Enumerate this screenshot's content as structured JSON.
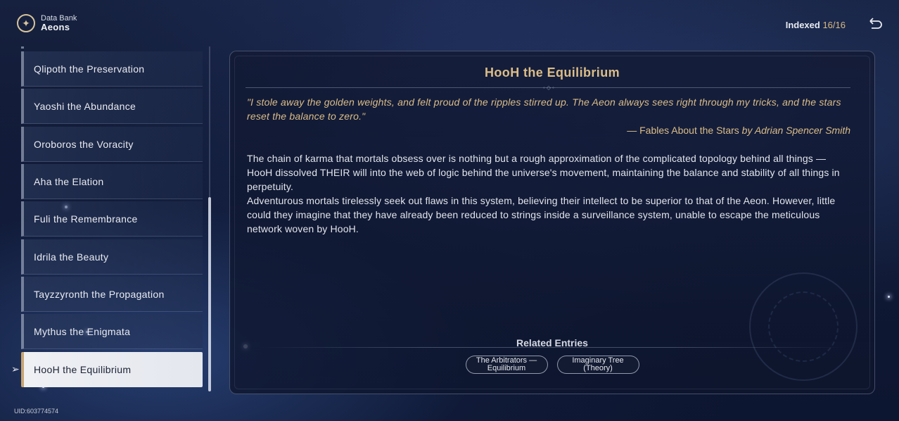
{
  "header": {
    "subtitle": "Data Bank",
    "title": "Aeons",
    "icon": "compass-emblem-icon"
  },
  "indexed": {
    "label": "Indexed",
    "count": "16/16"
  },
  "back_icon": "back-arrow-icon",
  "sidebar": {
    "items": [
      {
        "label": "Qlipoth the Preservation"
      },
      {
        "label": "Yaoshi the Abundance"
      },
      {
        "label": "Oroboros the Voracity"
      },
      {
        "label": "Aha the Elation"
      },
      {
        "label": "Fuli the Remembrance"
      },
      {
        "label": "Idrila the Beauty"
      },
      {
        "label": "Tayzzyronth the Propagation"
      },
      {
        "label": "Mythus the Enigmata"
      },
      {
        "label": "HooH the Equilibrium",
        "selected": true
      }
    ]
  },
  "uid": "UID:603774574",
  "entry": {
    "title": "HooH the Equilibrium",
    "quote": "\"I stole away the golden weights, and felt proud of the ripples stirred up. The Aeon always sees right through my tricks, and the stars reset the balance to zero.\"",
    "quote_source": "— Fables About the Stars",
    "quote_author": "by Adrian Spencer Smith",
    "paragraph_1": "The chain of karma that mortals obsess over is nothing but a rough approximation of the complicated topology behind all things — HooH dissolved THEIR will into the web of logic behind the universe's movement, maintaining the balance and stability of all things in perpetuity.",
    "paragraph_2": "Adventurous mortals tirelessly seek out flaws in this system, believing their intellect to be superior to that of the Aeon. However, little could they imagine that they have already been reduced to strings inside a surveillance system, unable to escape the meticulous network woven by HooH."
  },
  "related": {
    "label": "Related Entries",
    "entries": [
      {
        "label": "The Arbitrators — Equilibrium"
      },
      {
        "label": "Imaginary Tree (Theory)"
      }
    ]
  },
  "colors": {
    "accent_gold": "#dcbd88",
    "selected_bg": "#eef0f4",
    "panel_bg": "#121a34"
  }
}
